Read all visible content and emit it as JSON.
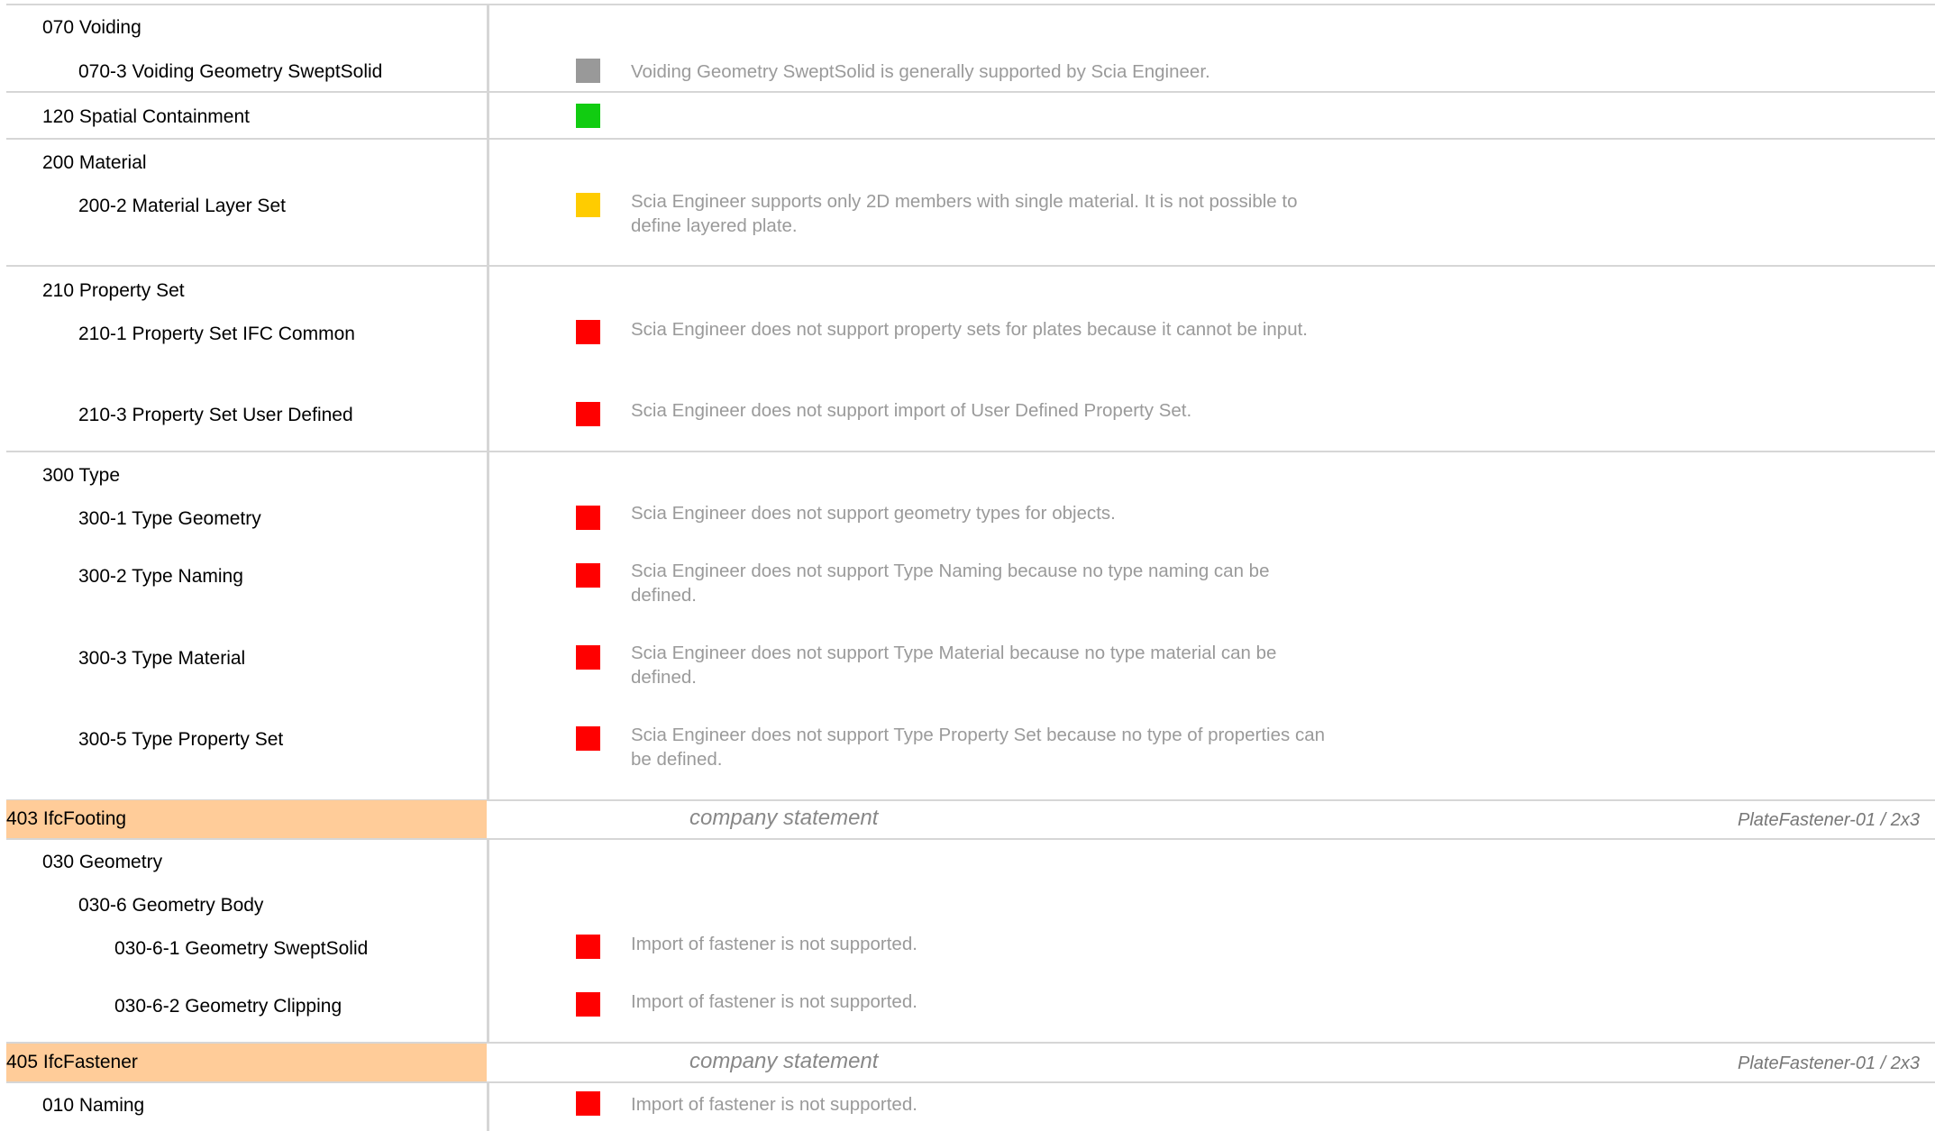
{
  "colors": {
    "status_gray": "#999999",
    "status_green": "#11cc11",
    "status_yellow": "#ffcc00",
    "status_red": "#ff0000",
    "band_background": "#ffcc99",
    "note_text": "#9a9a9a"
  },
  "rows": {
    "voiding": {
      "heading": "070 Voiding",
      "item_3": {
        "label": "070-3 Voiding Geometry SweptSolid",
        "status": "gray",
        "note": "Voiding Geometry SweptSolid is generally supported by Scia Engineer."
      }
    },
    "spatial": {
      "label": "120 Spatial Containment",
      "status": "green"
    },
    "material": {
      "heading": "200 Material",
      "item_2": {
        "label": "200-2 Material Layer Set",
        "status": "yellow",
        "note": "Scia Engineer supports only 2D members with single material. It is not possible to define layered plate."
      }
    },
    "property_set": {
      "heading": "210 Property Set",
      "item_1": {
        "label": "210-1 Property Set IFC Common",
        "status": "red",
        "note": "Scia Engineer does not support property sets for plates because it cannot be input."
      },
      "item_3": {
        "label": "210-3 Property Set User Defined",
        "status": "red",
        "note": "Scia Engineer does not support import of User Defined Property Set."
      }
    },
    "type": {
      "heading": "300 Type",
      "item_1": {
        "label": "300-1 Type Geometry",
        "status": "red",
        "note": "Scia Engineer does not support geometry types for objects."
      },
      "item_2": {
        "label": "300-2 Type Naming",
        "status": "red",
        "note": "Scia Engineer does not support Type Naming because no type naming can be defined."
      },
      "item_3": {
        "label": "300-3 Type Material",
        "status": "red",
        "note": "Scia Engineer does not support Type Material because no type material can be defined."
      },
      "item_5": {
        "label": "300-5 Type Property Set",
        "status": "red",
        "note": "Scia Engineer does not support Type Property Set because no type of properties can be defined."
      }
    }
  },
  "sections": {
    "footing": {
      "title": "403 IfcFooting",
      "statement": "company statement",
      "reference": "PlateFastener-01 / 2x3",
      "geometry": {
        "heading": "030 Geometry",
        "body": {
          "heading": "030-6 Geometry Body",
          "item_1": {
            "label": "030-6-1 Geometry SweptSolid",
            "status": "red",
            "note": "Import of fastener is not supported."
          },
          "item_2": {
            "label": "030-6-2 Geometry Clipping",
            "status": "red",
            "note": "Import of fastener is not supported."
          }
        }
      }
    },
    "fastener": {
      "title": "405 IfcFastener",
      "statement": "company statement",
      "reference": "PlateFastener-01 / 2x3",
      "naming": {
        "label": "010 Naming",
        "status": "red",
        "note": "Import of fastener is not supported."
      }
    }
  }
}
